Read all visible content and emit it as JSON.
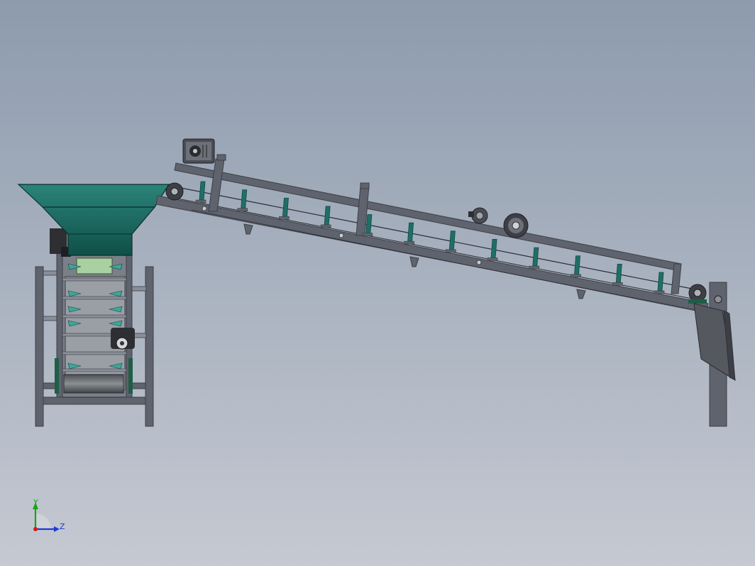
{
  "viewport": {
    "background_top": "#8d9bad",
    "background_bottom": "#c5c9d2"
  },
  "colors": {
    "frame_gray": "#5f636d",
    "frame_dark": "#3c3f46",
    "frame_light": "#8a8e97",
    "teal": "#1f6f66",
    "teal_dark": "#0f4a44",
    "teal_light": "#3fa69a",
    "drum": "#6c6f72",
    "panel_green": "#a8d0a0",
    "motor": "#2d2f33",
    "bracket": "#2d2f33"
  },
  "triad": {
    "y_label": "Y",
    "z_label": "Z",
    "y_color": "#1aa31a",
    "z_color": "#1f3bd1",
    "x_color": "#d81919"
  },
  "model": {
    "conveyor_cleat_count": 12,
    "conveyor_bottom_rail_length_ratio": 1.0
  }
}
